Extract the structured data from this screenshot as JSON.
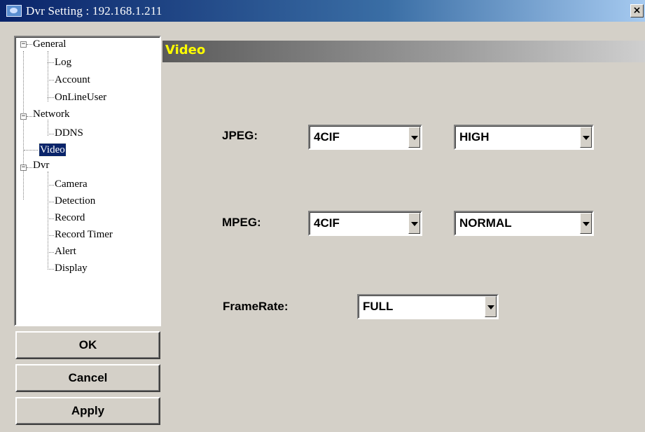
{
  "window": {
    "title": "Dvr Setting : 192.168.1.211",
    "close_glyph": "×"
  },
  "tree": {
    "general": "General",
    "log": "Log",
    "account": "Account",
    "onlineuser": "OnLineUser",
    "network": "Network",
    "ddns": "DDNS",
    "video": "Video",
    "dvr": "Dvr",
    "camera": "Camera",
    "detection": "Detection",
    "record": "Record",
    "record_timer": "Record Timer",
    "alert": "Alert",
    "display": "Display",
    "expanded_glyph": "−"
  },
  "buttons": {
    "ok": "OK",
    "cancel": "Cancel",
    "apply": "Apply"
  },
  "section": {
    "title": "Video"
  },
  "fields": {
    "jpeg": {
      "label": "JPEG:",
      "resolution": "4CIF",
      "quality": "HIGH"
    },
    "mpeg": {
      "label": "MPEG:",
      "resolution": "4CIF",
      "quality": "NORMAL"
    },
    "framerate": {
      "label": "FrameRate:",
      "value": "FULL"
    }
  },
  "colors": {
    "title_bar": "#0a246a",
    "section_title": "#ffff00",
    "window_bg": "#d4d0c8",
    "selection": "#0a246a"
  }
}
